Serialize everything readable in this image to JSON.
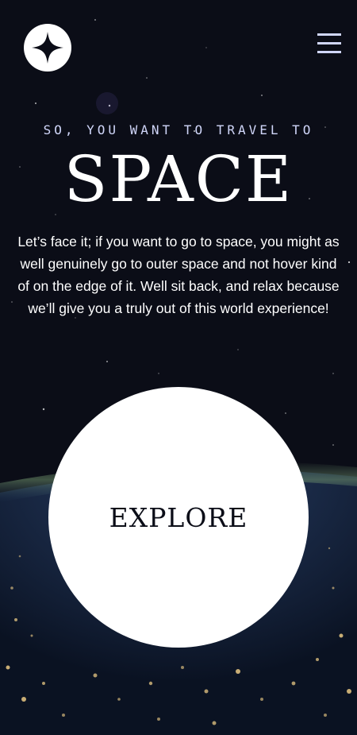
{
  "header": {
    "logo_icon": "star-logo-icon",
    "menu_icon": "hamburger-menu-icon"
  },
  "hero": {
    "eyebrow": "SO, YOU WANT TO TRAVEL TO",
    "title": "SPACE",
    "body": "Let’s face it; if you want to go to space, you might as well genuinely go to outer space and not hover kind of on the edge of it. Well sit back, and relax because we’ll give you a truly out of this world experience!",
    "cta_label": "EXPLORE"
  },
  "colors": {
    "background": "#0b0d17",
    "accent_light": "#d0d6f9",
    "white": "#ffffff"
  }
}
